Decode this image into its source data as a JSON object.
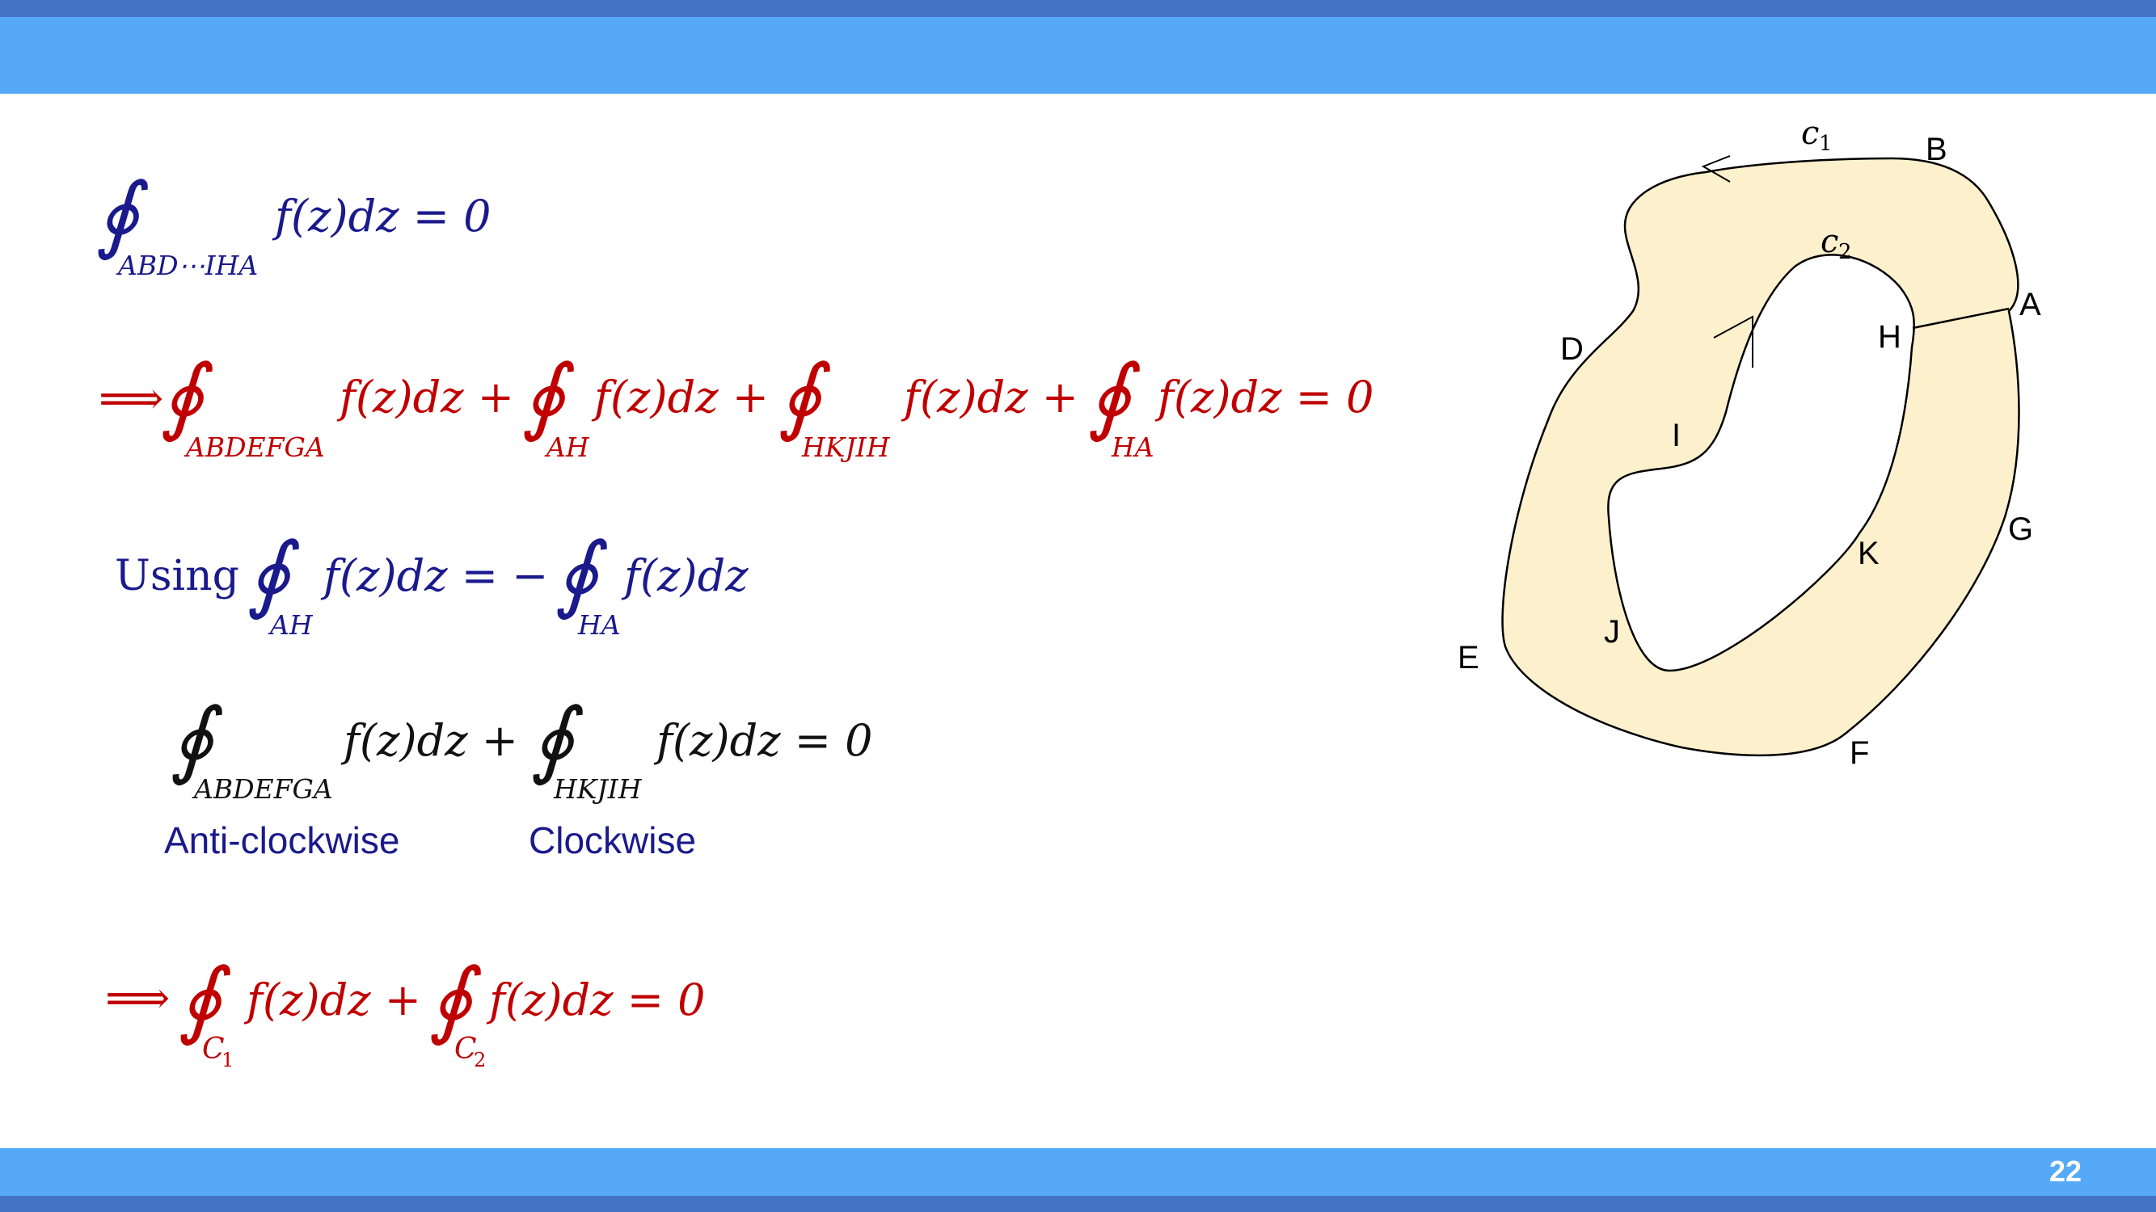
{
  "slide": {
    "number": "22",
    "colors": {
      "bar": "#55a9f7",
      "bar_edge": "#4472c4",
      "navy": "#1a1a8c",
      "red": "#c00000",
      "fill": "#fdf0cc"
    }
  },
  "equations": {
    "eq1": {
      "sub": "ABD⋯IHA",
      "body": "f(z)dz = 0"
    },
    "eq2": {
      "implies": "⟹",
      "terms": [
        {
          "sub": "ABDEFGA",
          "body": "f(z)dz +"
        },
        {
          "sub": "AH",
          "body": "f(z)dz +"
        },
        {
          "sub": "HKJIH",
          "body": "f(z)dz +"
        },
        {
          "sub": "HA",
          "body": "f(z)dz = 0"
        }
      ]
    },
    "eq3": {
      "prefix": "Using",
      "t1_sub": "AH",
      "t1_body": "f(z)dz = −",
      "t2_sub": "HA",
      "t2_body": "f(z)dz"
    },
    "eq4": {
      "t1_sub": "ABDEFGA",
      "t1_body": "f(z)dz +",
      "t2_sub": "HKJIH",
      "t2_body": "f(z)dz = 0"
    },
    "labels": {
      "anticlockwise": "Anti-clockwise",
      "clockwise": "Clockwise"
    },
    "eq5": {
      "implies": "⟹",
      "t1_sub": "C",
      "t1_idx": "1",
      "t1_body": "f(z)dz +",
      "t2_sub": "C",
      "t2_idx": "2",
      "t2_body": "f(z)dz = 0"
    }
  },
  "diagram": {
    "c1": "c",
    "c1_idx": "1",
    "c2": "c",
    "c2_idx": "2",
    "points": {
      "A": "A",
      "B": "B",
      "D": "D",
      "E": "E",
      "F": "F",
      "G": "G",
      "H": "H",
      "I": "I",
      "J": "J",
      "K": "K"
    }
  }
}
